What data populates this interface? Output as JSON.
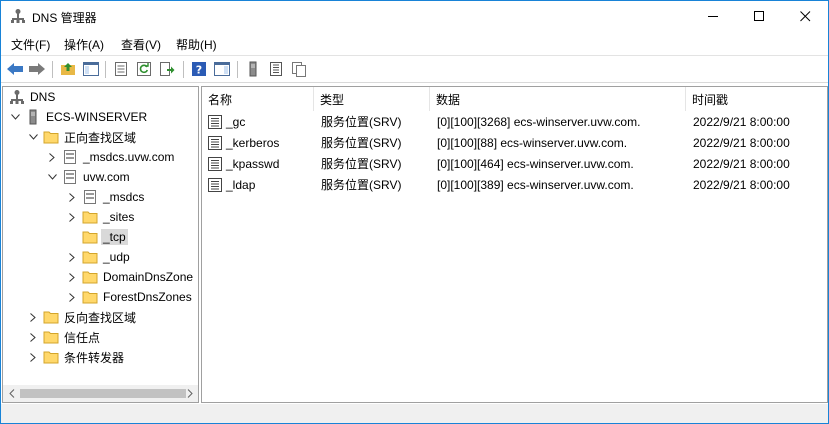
{
  "window": {
    "title": "DNS 管理器"
  },
  "menu": {
    "file": "文件(F)",
    "action": "操作(A)",
    "view": "查看(V)",
    "help": "帮助(H)"
  },
  "tree": {
    "root": "DNS",
    "server": "ECS-WINSERVER",
    "forward_zones": "正向查找区域",
    "msdcs_zone": "_msdcs.uvw.com",
    "uvw_zone": "uvw.com",
    "msdcs": "_msdcs",
    "sites": "_sites",
    "tcp": "_tcp",
    "udp": "_udp",
    "domain_dns_zones": "DomainDnsZone",
    "forest_dns_zones": "ForestDnsZones",
    "reverse_zones": "反向查找区域",
    "trust_points": "信任点",
    "conditional_forwarders": "条件转发器"
  },
  "table": {
    "columns": [
      "名称",
      "类型",
      "数据",
      "时间戳"
    ],
    "rows": [
      {
        "name": "_gc",
        "type": "服务位置(SRV)",
        "data": "[0][100][3268] ecs-winserver.uvw.com.",
        "timestamp": "2022/9/21 8:00:00"
      },
      {
        "name": "_kerberos",
        "type": "服务位置(SRV)",
        "data": "[0][100][88] ecs-winserver.uvw.com.",
        "timestamp": "2022/9/21 8:00:00"
      },
      {
        "name": "_kpasswd",
        "type": "服务位置(SRV)",
        "data": "[0][100][464] ecs-winserver.uvw.com.",
        "timestamp": "2022/9/21 8:00:00"
      },
      {
        "name": "_ldap",
        "type": "服务位置(SRV)",
        "data": "[0][100][389] ecs-winserver.uvw.com.",
        "timestamp": "2022/9/21 8:00:00"
      }
    ]
  },
  "colors": {
    "accent": "#1883d7",
    "folder": "#ffd86b",
    "selection": "#d9d9d9"
  }
}
